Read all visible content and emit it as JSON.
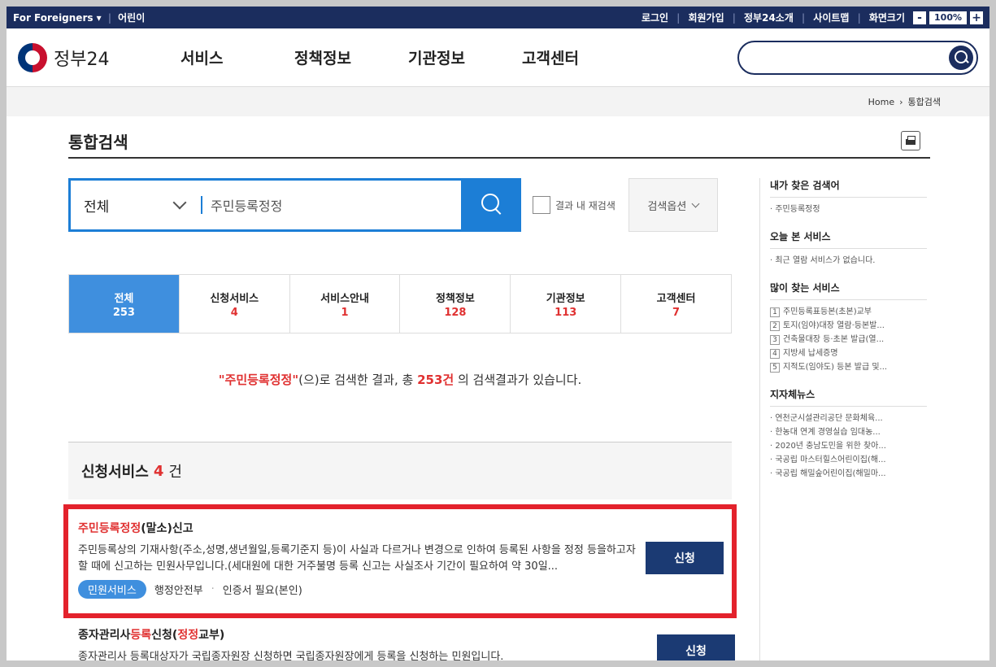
{
  "topbar": {
    "foreigners": "For Foreigners ▾",
    "kids": "어린이",
    "login": "로그인",
    "signup": "회원가입",
    "about": "정부24소개",
    "sitemap": "사이트맵",
    "screen_size": "화면크기",
    "zoom": "100%",
    "minus": "-",
    "plus": "+"
  },
  "header": {
    "logo_text": "정부24",
    "nav": [
      "서비스",
      "정책정보",
      "기관정보",
      "고객센터"
    ]
  },
  "breadcrumb": {
    "home": "Home",
    "sep": "›",
    "current": "통합검색"
  },
  "page": {
    "title": "통합검색"
  },
  "search": {
    "scope": "전체",
    "query": "주민등록정정",
    "research_label": "결과 내 재검색",
    "options_label": "검색옵션"
  },
  "tabs": [
    {
      "label": "전체",
      "count": "253"
    },
    {
      "label": "신청서비스",
      "count": "4"
    },
    {
      "label": "서비스안내",
      "count": "1"
    },
    {
      "label": "정책정보",
      "count": "128"
    },
    {
      "label": "기관정보",
      "count": "113"
    },
    {
      "label": "고객센터",
      "count": "7"
    }
  ],
  "summary": {
    "query_quoted": "\"주민등록정정\"",
    "text1": "(으)로 검색한 결과, 총 ",
    "total": "253건",
    "text2": " 의 검색결과가 있습니다."
  },
  "section": {
    "title": "신청서비스",
    "count": "4",
    "unit": "건"
  },
  "results": [
    {
      "title_hl": "주민등록정정",
      "title_rest": "(말소)신고",
      "desc": "주민등록상의 기재사항(주소,성명,생년월일,등록기준지 등)이 사실과 다르거나 변경으로 인하여 등록된 사항을 정정 등을하고자 할 때에 신고하는 민원사무입니다.(세대원에 대한 거주불명 등록 신고는 사실조사 기간이 필요하여 약 30일...",
      "badge": "민원서비스",
      "agency": "행정안전부",
      "cert": "인증서 필요(본인)",
      "apply": "신청"
    },
    {
      "title_a": "종자관리사",
      "title_hl1": "등록",
      "title_b": "신청(",
      "title_hl2": "정정",
      "title_c": "교부)",
      "desc": "종자관리사 등록대상자가 국립종자원장 신청하면 국립종자원장에게 등록을 신청하는 민원입니다.",
      "apply": "신청"
    }
  ],
  "sidebar": {
    "my_search_title": "내가 찾은 검색어",
    "my_search": [
      "주민등록정정"
    ],
    "today_title": "오늘 본 서비스",
    "today": [
      "최근 열람 서비스가 없습니다."
    ],
    "popular_title": "많이 찾는 서비스",
    "popular": [
      {
        "n": "1",
        "t": "주민등록표등본(초본)교부"
      },
      {
        "n": "2",
        "t": "토지(임야)대장 열람·등본발..."
      },
      {
        "n": "3",
        "t": "건축물대장 등·초본 발급(열..."
      },
      {
        "n": "4",
        "t": "지방세 납세증명"
      },
      {
        "n": "5",
        "t": "지적도(임야도) 등본 발급 및..."
      }
    ],
    "news_title": "지자체뉴스",
    "news": [
      "연천군시설관리공단 문화체육...",
      "한농대 연계 경영실습 임대농...",
      "2020년 충남도민을 위한 찾아...",
      "국공립 마스터힐스어린이집(해...",
      "국공립 해밀숲어린이집(해밀마..."
    ]
  }
}
